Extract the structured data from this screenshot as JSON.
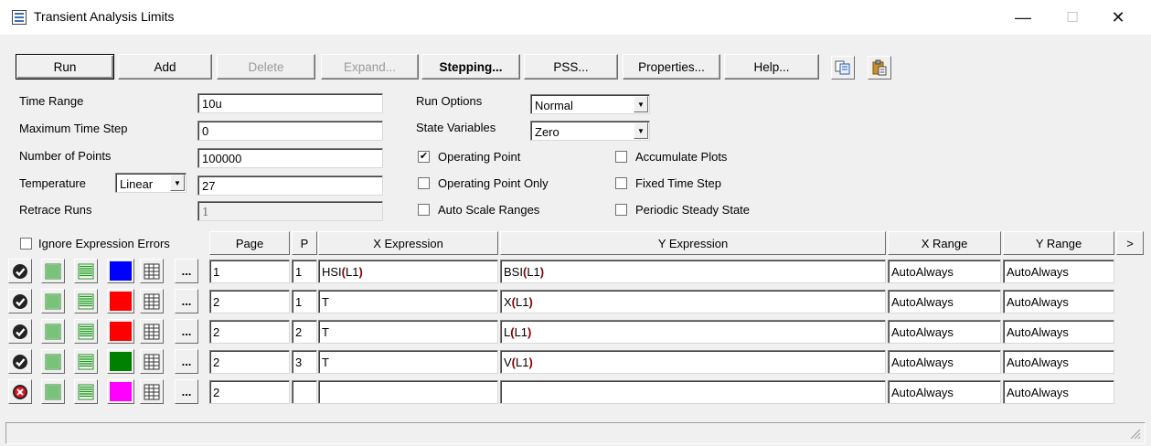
{
  "window": {
    "title": "Transient Analysis Limits",
    "icon": "grid-window-icon",
    "controls": {
      "minimize": "—",
      "maximize": "☐",
      "close": "✕"
    }
  },
  "toolbar": {
    "run": "Run",
    "add": "Add",
    "delete": "Delete",
    "expand": "Expand...",
    "stepping": "Stepping...",
    "pss": "PSS...",
    "properties": "Properties...",
    "help": "Help...",
    "copy_icon": "copy-icon",
    "paste_icon": "paste-icon"
  },
  "settings": {
    "time_range": {
      "label": "Time Range",
      "value": "10u"
    },
    "max_time_step": {
      "label": "Maximum Time Step",
      "value": "0"
    },
    "num_points": {
      "label": "Number of Points",
      "value": "100000"
    },
    "temperature": {
      "label": "Temperature",
      "mode": "Linear",
      "value": "27"
    },
    "retrace_runs": {
      "label": "Retrace Runs",
      "value": "1"
    },
    "run_options": {
      "label": "Run Options",
      "value": "Normal"
    },
    "state_variables": {
      "label": "State Variables",
      "value": "Zero"
    }
  },
  "options": {
    "operating_point": {
      "label": "Operating Point",
      "checked": true
    },
    "operating_point_only": {
      "label": "Operating Point Only",
      "checked": false
    },
    "auto_scale_ranges": {
      "label": "Auto Scale Ranges",
      "checked": false
    },
    "accumulate_plots": {
      "label": "Accumulate Plots",
      "checked": false
    },
    "fixed_time_step": {
      "label": "Fixed Time Step",
      "checked": false
    },
    "periodic_steady_state": {
      "label": "Periodic Steady State",
      "checked": false
    },
    "ignore_expression_errors": {
      "label": "Ignore Expression Errors",
      "checked": false
    }
  },
  "table": {
    "headers": {
      "page": "Page",
      "p": "P",
      "x_expr": "X Expression",
      "y_expr": "Y Expression",
      "x_range": "X Range",
      "y_range": "Y Range",
      "more": ">"
    },
    "rows": [
      {
        "enabled": true,
        "color": "#0000ff",
        "page": "1",
        "p": "1",
        "x_expr": "HSI(L1)",
        "y_expr": "BSI(L1)",
        "x_range": "AutoAlways",
        "y_range": "AutoAlways"
      },
      {
        "enabled": true,
        "color": "#ff0000",
        "page": "2",
        "p": "1",
        "x_expr": "T",
        "y_expr": "X(L1)",
        "x_range": "AutoAlways",
        "y_range": "AutoAlways"
      },
      {
        "enabled": true,
        "color": "#ff0000",
        "page": "2",
        "p": "2",
        "x_expr": "T",
        "y_expr": "L(L1)",
        "x_range": "AutoAlways",
        "y_range": "AutoAlways"
      },
      {
        "enabled": true,
        "color": "#008000",
        "page": "2",
        "p": "3",
        "x_expr": "T",
        "y_expr": "V(L1)",
        "x_range": "AutoAlways",
        "y_range": "AutoAlways"
      },
      {
        "enabled": false,
        "color": "#ff00ff",
        "page": "2",
        "p": "",
        "x_expr": "",
        "y_expr": "",
        "x_range": "AutoAlways",
        "y_range": "AutoAlways"
      }
    ]
  }
}
